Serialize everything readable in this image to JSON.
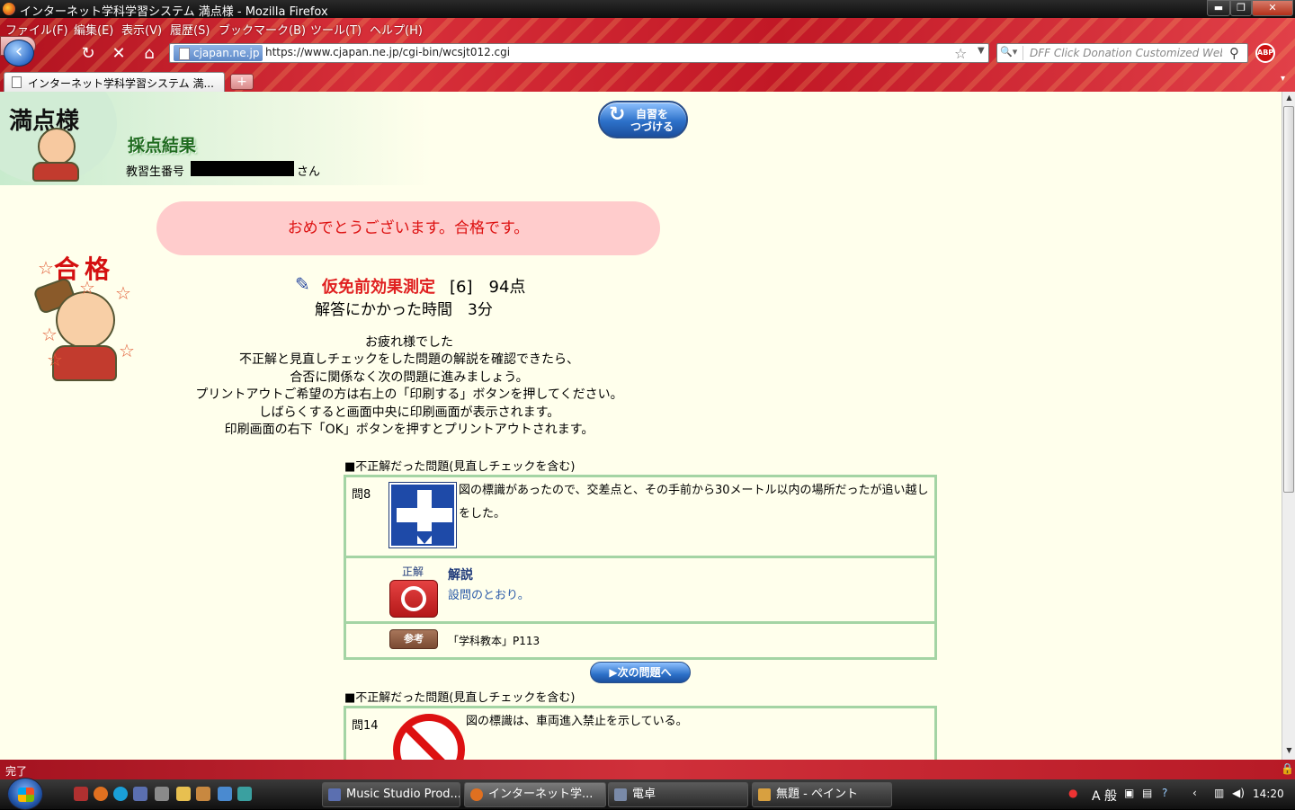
{
  "window": {
    "title": "インターネット学科学習システム 満点様 - Mozilla Firefox",
    "min": "▬",
    "max": "❐",
    "close": "✕"
  },
  "menu": [
    "ファイル(F)",
    "編集(E)",
    "表示(V)",
    "履歴(S)",
    "ブックマーク(B)",
    "ツール(T)",
    "ヘルプ(H)"
  ],
  "nav": {
    "site_badge": "cjapan.ne.jp",
    "url": "https://www.cjapan.ne.jp/cgi-bin/wcsjt012.cgi",
    "search_placeholder": "DFF Click Donation Customized Web S",
    "abp": "ABP"
  },
  "tabs": [
    {
      "label": "インターネット学科学習システム 満..."
    }
  ],
  "tab_new": "+",
  "page": {
    "logo": "満点様",
    "title": "採点結果",
    "student_label": "教習生番号",
    "student_suffix": "さん",
    "continue_button": "自習を\nつづける",
    "congrats": "おめでとうございます。合格です。",
    "pass_stamp": "合格",
    "test_name": "仮免前効果測定",
    "test_score": "[6]　94点",
    "time_line": "解答にかかった時間　3分",
    "message_lines": [
      "お疲れ様でした",
      "不正解と見直しチェックをした問題の解説を確認できたら、",
      "合否に関係なく次の問題に進みましょう。",
      "プリントアウトご希望の方は右上の「印刷する」ボタンを押してください。",
      "しばらくすると画面中央に印刷画面が表示されます。",
      "印刷画面の右下「OK」ボタンを押すとプリントアウトされます。"
    ],
    "section_heading": "■不正解だった問題(見直しチェックを含む)",
    "question1": {
      "number": "問8",
      "text": "図の標識があったので、交差点と、その手前から30メートル以内の場所だったが追い越しをした。",
      "correct_label": "正解",
      "explain_title": "解説",
      "explain_body": "設問のとおり。",
      "ref_badge": "参考",
      "ref_text": "「学科教本」P113"
    },
    "next_button": "▶次の問題へ",
    "question2": {
      "number": "問14",
      "text": "図の標識は、車両進入禁止を示している。"
    }
  },
  "status": {
    "text": "完了"
  },
  "taskbar": {
    "tasks": [
      {
        "label": "Music Studio Prod...",
        "icon_color": "#5b6fb0"
      },
      {
        "label": "インターネット学...",
        "icon_color": "#e07020"
      },
      {
        "label": "電卓",
        "icon_color": "#7a8aa8"
      },
      {
        "label": "無題 - ペイント",
        "icon_color": "#d8a040"
      }
    ],
    "clock": "14:20",
    "ime": "A 般"
  }
}
